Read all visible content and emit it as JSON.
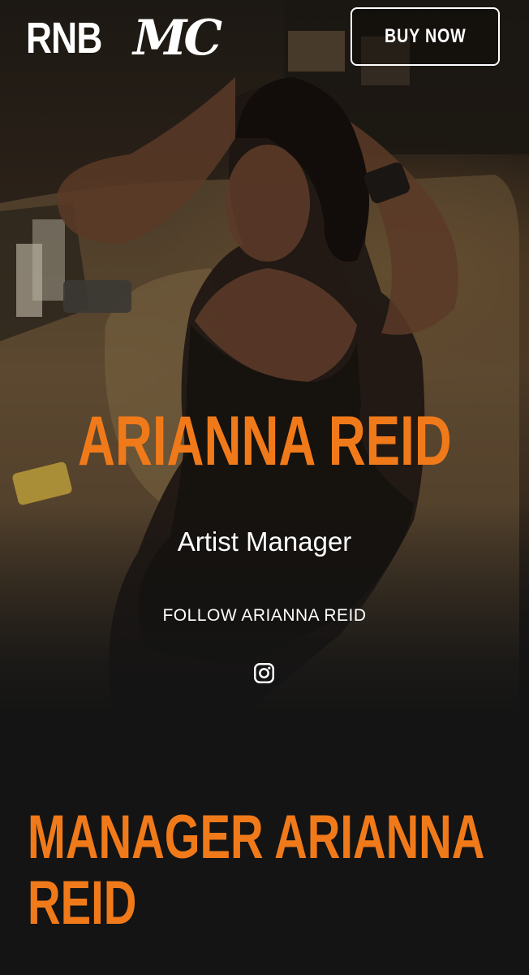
{
  "header": {
    "logo_text_a": "RNB",
    "logo_text_b": "MC",
    "buy_label": "BUY NOW"
  },
  "hero": {
    "name": "ARIANNA REID",
    "role": "Artist Manager",
    "follow_label": "FOLLOW ARIANNA REID",
    "social_icon": "instagram-icon"
  },
  "section": {
    "title_line1": "MANAGER ARIANNA",
    "title_line2": "REID"
  },
  "colors": {
    "accent": "#f07a1a",
    "background": "#141414",
    "text": "#ffffff"
  }
}
